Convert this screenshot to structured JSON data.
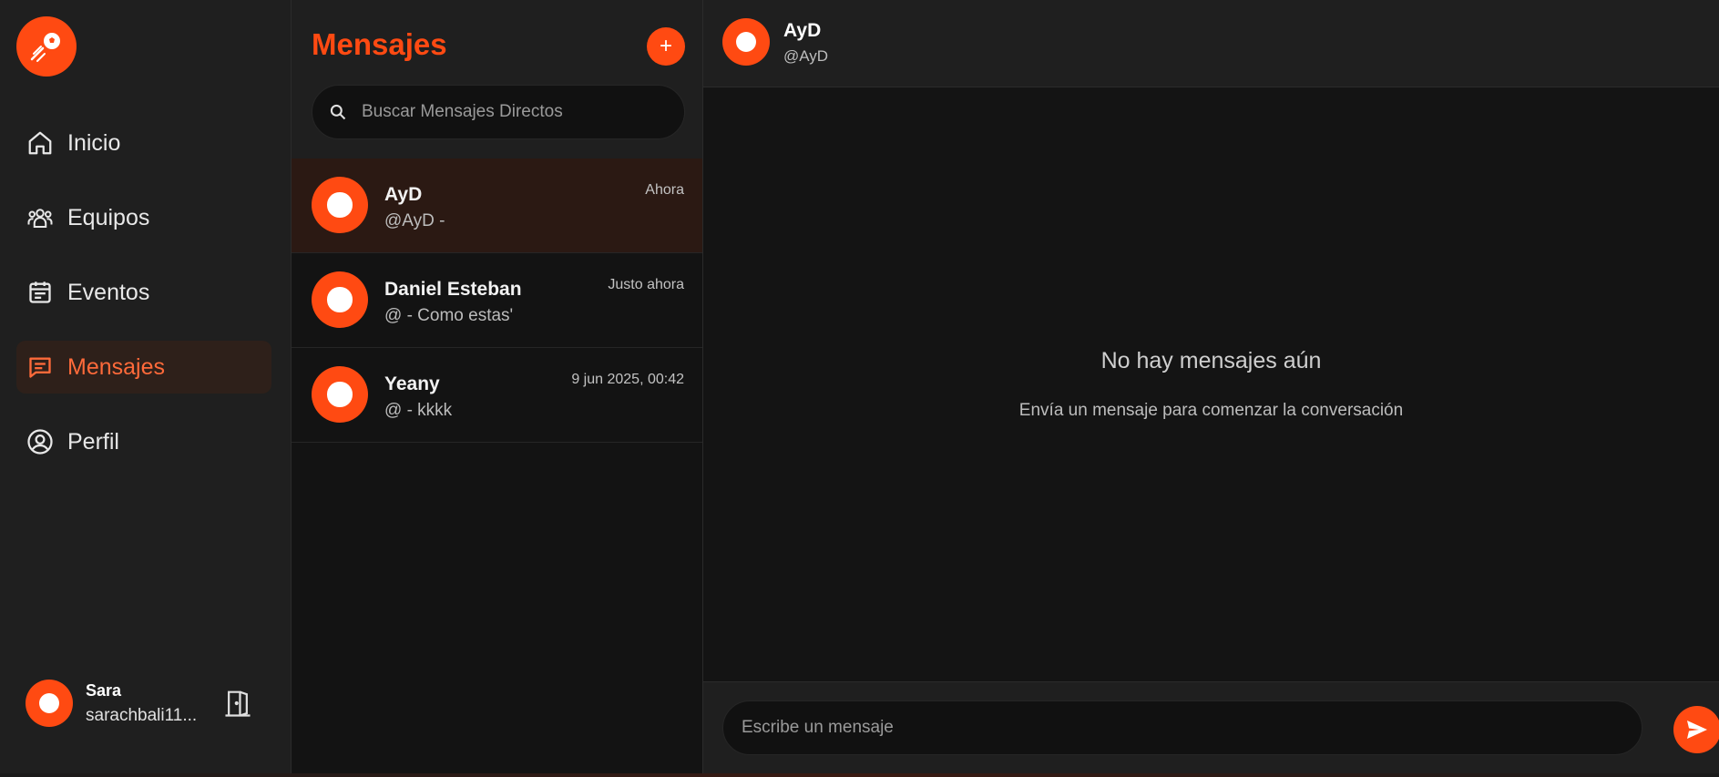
{
  "colors": {
    "accent": "#ff4a12",
    "sidebar_bg": "#1f1f1f",
    "main_bg": "#141414",
    "selected_row": "#2b1913",
    "active_nav": "#2e201a"
  },
  "sidebar": {
    "logo_icon": "soccer-ball-logo",
    "items": [
      {
        "label": "Inicio",
        "icon": "home-icon",
        "active": false
      },
      {
        "label": "Equipos",
        "icon": "team-icon",
        "active": false
      },
      {
        "label": "Eventos",
        "icon": "calendar-icon",
        "active": false
      },
      {
        "label": "Mensajes",
        "icon": "chat-icon",
        "active": true
      },
      {
        "label": "Perfil",
        "icon": "user-circle-icon",
        "active": false
      }
    ],
    "user": {
      "name": "Sara",
      "handle": "sarachbali11..."
    },
    "logout_icon": "door-icon"
  },
  "conversations": {
    "title": "Mensajes",
    "add_label": "+",
    "search_placeholder": "Buscar Mensajes Directos",
    "items": [
      {
        "name": "AyD",
        "preview": "@AyD -",
        "time": "Ahora",
        "selected": true
      },
      {
        "name": "Daniel Esteban",
        "preview": "@ - Como estas'",
        "time": "Justo ahora",
        "selected": false
      },
      {
        "name": "Yeany",
        "preview": "@ - kkkk",
        "time": "9 jun 2025, 00:42",
        "selected": false
      }
    ]
  },
  "chat": {
    "name": "AyD",
    "handle": "@AyD",
    "empty_title": "No hay mensajes aún",
    "empty_subtitle": "Envía un mensaje para comenzar la conversación",
    "input_placeholder": "Escribe un mensaje",
    "send_icon": "send-icon"
  }
}
